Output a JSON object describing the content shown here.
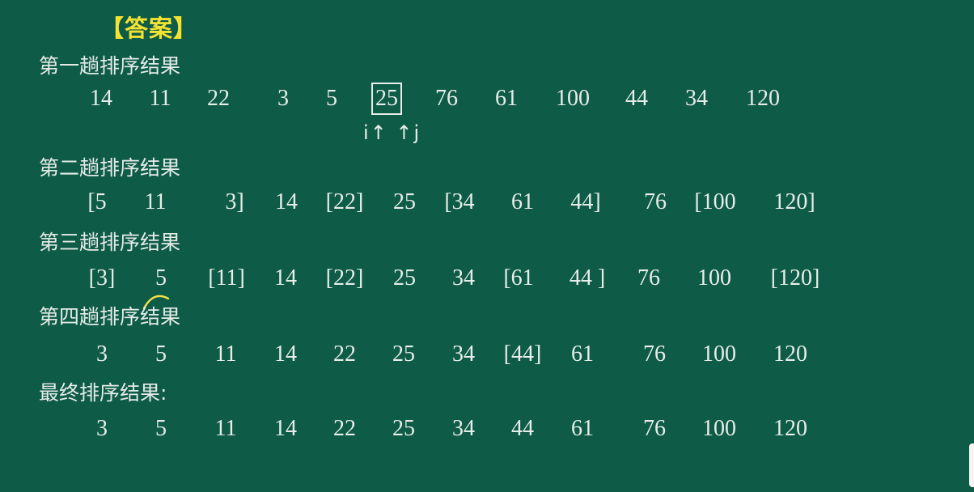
{
  "answer_label": "【答案】",
  "passes": [
    {
      "heading": "第一趟排序结果",
      "tokens": [
        "14",
        "11",
        "22",
        "3",
        "5",
        "25",
        "76",
        "61",
        "100",
        "44",
        "34",
        "120"
      ],
      "pointer": "i↑ ↑j"
    },
    {
      "heading": "第二趟排序结果",
      "tokens": [
        "[5",
        "11",
        "3]",
        "14",
        "[22]",
        "25",
        "[34",
        "61",
        "44]",
        "76",
        "[100",
        "120]"
      ]
    },
    {
      "heading": "第三趟排序结果",
      "tokens": [
        "[3]",
        "5",
        "[11]",
        "14",
        "[22]",
        "25",
        "34",
        "[61",
        "44 ]",
        "76",
        "100",
        "[120]"
      ]
    },
    {
      "heading": "第四趟排序结果",
      "tokens": [
        "3",
        "5",
        "11",
        "14",
        "22",
        "25",
        "34",
        "[44]",
        "61",
        "76",
        "100",
        "120"
      ]
    },
    {
      "heading": "最终排序结果:",
      "tokens": [
        "3",
        "5",
        "11",
        "14",
        "22",
        "25",
        "34",
        "44",
        "61",
        "76",
        "100",
        "120"
      ]
    }
  ],
  "colors": {
    "board": "#0e5b47",
    "text": "#e7ede9",
    "answer": "#f3e232"
  }
}
